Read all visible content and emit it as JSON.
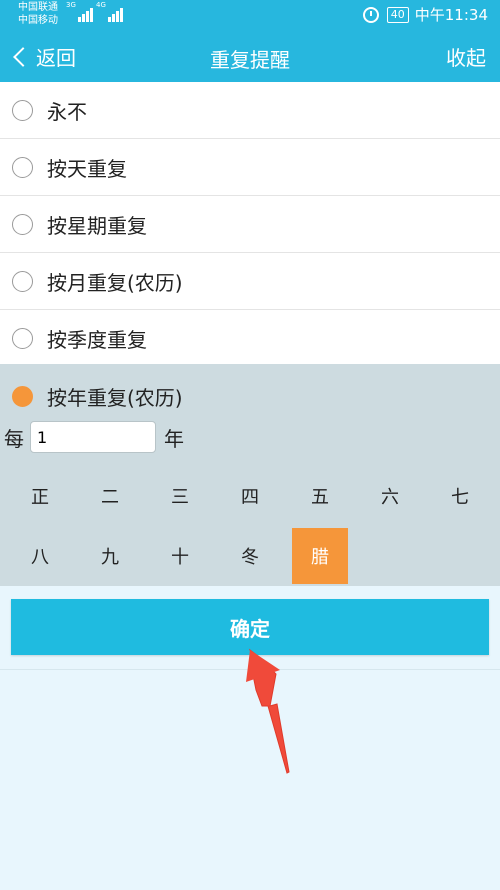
{
  "status_bar": {
    "carrier1": "中国联通",
    "carrier2": "中国移动",
    "net1": "3G",
    "net2": "4G",
    "battery": "40",
    "time": "中午11:34"
  },
  "header": {
    "back_label": "返回",
    "title": "重复提醒",
    "collapse_label": "收起"
  },
  "options": [
    {
      "label": "永不",
      "selected": false
    },
    {
      "label": "按天重复",
      "selected": false
    },
    {
      "label": "按星期重复",
      "selected": false
    },
    {
      "label": "按月重复(农历)",
      "selected": false
    },
    {
      "label": "按季度重复",
      "selected": false
    },
    {
      "label": "按年重复(农历)",
      "selected": true
    }
  ],
  "interval": {
    "prefix": "每",
    "value": "1",
    "suffix": "年"
  },
  "months": [
    "正",
    "二",
    "三",
    "四",
    "五",
    "六",
    "七",
    "八",
    "九",
    "十",
    "冬",
    "腊"
  ],
  "selected_month": "腊",
  "confirm_label": "确定",
  "colors": {
    "accent": "#27b7de",
    "selected": "#f5963a",
    "annotation_arrow": "#f04a3a"
  },
  "icons": {
    "back": "chevron-left-icon",
    "alarm": "alarm-clock-icon",
    "radio": "radio-button-icon"
  }
}
